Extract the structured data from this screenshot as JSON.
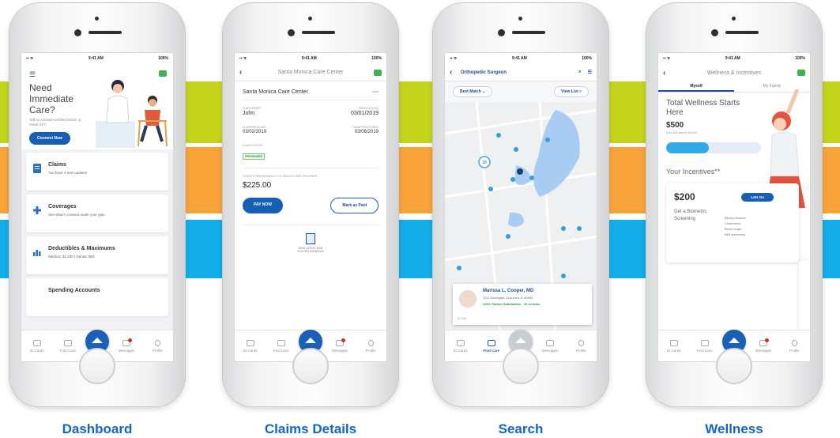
{
  "status": {
    "time": "9:41 AM",
    "battery": "100%"
  },
  "tabs": {
    "id_cards": "ID Cards",
    "find_care": "Find Care",
    "messages": "Messages",
    "profile": "Profile"
  },
  "captions": [
    "Dashboard",
    "Claims Details",
    "Search",
    "Wellness"
  ],
  "colors": {
    "primary": "#1560b3",
    "stripe_green": "#c5d51b",
    "stripe_orange": "#f9a43a",
    "stripe_blue": "#13aeea",
    "caption": "#1466c4"
  },
  "dashboard": {
    "hero_title": "Need Immediate Care?",
    "hero_text": "Talk to a board-certified doctor or nurse 24/7",
    "connect_button": "Connect Now",
    "cards": [
      {
        "icon": "document-icon",
        "title": "Claims",
        "text": "You have 4 new updates"
      },
      {
        "icon": "plus-icon",
        "title": "Coverages",
        "text": "See what's covered under your plan"
      },
      {
        "icon": "bar-chart-icon",
        "title": "Deductibles & Maximums",
        "text": "Medical: $1,500  |  Dental: $50"
      },
      {
        "icon": "wallet-icon",
        "title": "Spending Accounts",
        "text": ""
      }
    ]
  },
  "claims": {
    "nav_title": "Santa Monica Care Center",
    "provider": "Santa Monica Care Center",
    "view": "view",
    "subscriber_label": "SUBSCRIBER",
    "subscriber": "John",
    "service_date_label": "SERVICE DATE",
    "service_date": "03/01/2019",
    "received_label": "CLAIM RECEIVED",
    "received": "03/02/2019",
    "processed_label": "CLAIM PROCESSED",
    "processed": "03/06/2019",
    "status_label": "CLAIM STATUS",
    "status": "PROCESSED",
    "responsibility_label": "PATIENT RESPONSIBILITY TO HEALTH CARE PROVIDER",
    "amount": "$225.00",
    "pay_now": "PAY NOW",
    "mark_paid": "Mark as Paid",
    "doc_line1": "NEW LATEST EOB",
    "doc_line2": "POSTED 03/06/2019"
  },
  "search": {
    "query": "Orthopedic Surgeon",
    "best_match": "Best Match",
    "view_list": "View List",
    "cluster": "18",
    "doctor_name": "Marissa L. Cooper, MD",
    "doctor_address": "1112 Southgate Ct Aurora, IL 60504",
    "satisfaction": "100% Patient Satisfaction · 30 reviews",
    "distance": "0.2 mi"
  },
  "wellness": {
    "nav_title": "Wellness & Incentives",
    "tab_myself": "Myself",
    "tab_family": "My Family",
    "headline": "Total Wellness Starts Here",
    "amount": "$500",
    "amount_note": "of $1,500 payroll deposit*",
    "progress": 0.45,
    "incentives_title": "Your Incentives**",
    "card_amount": "$200",
    "lets_go": "Lets Go",
    "card_desc": "Get a Biometric Screening",
    "card_items": [
      "Blood pressure",
      "Cholesterol",
      "Blood sugar",
      "BMI screening"
    ]
  }
}
